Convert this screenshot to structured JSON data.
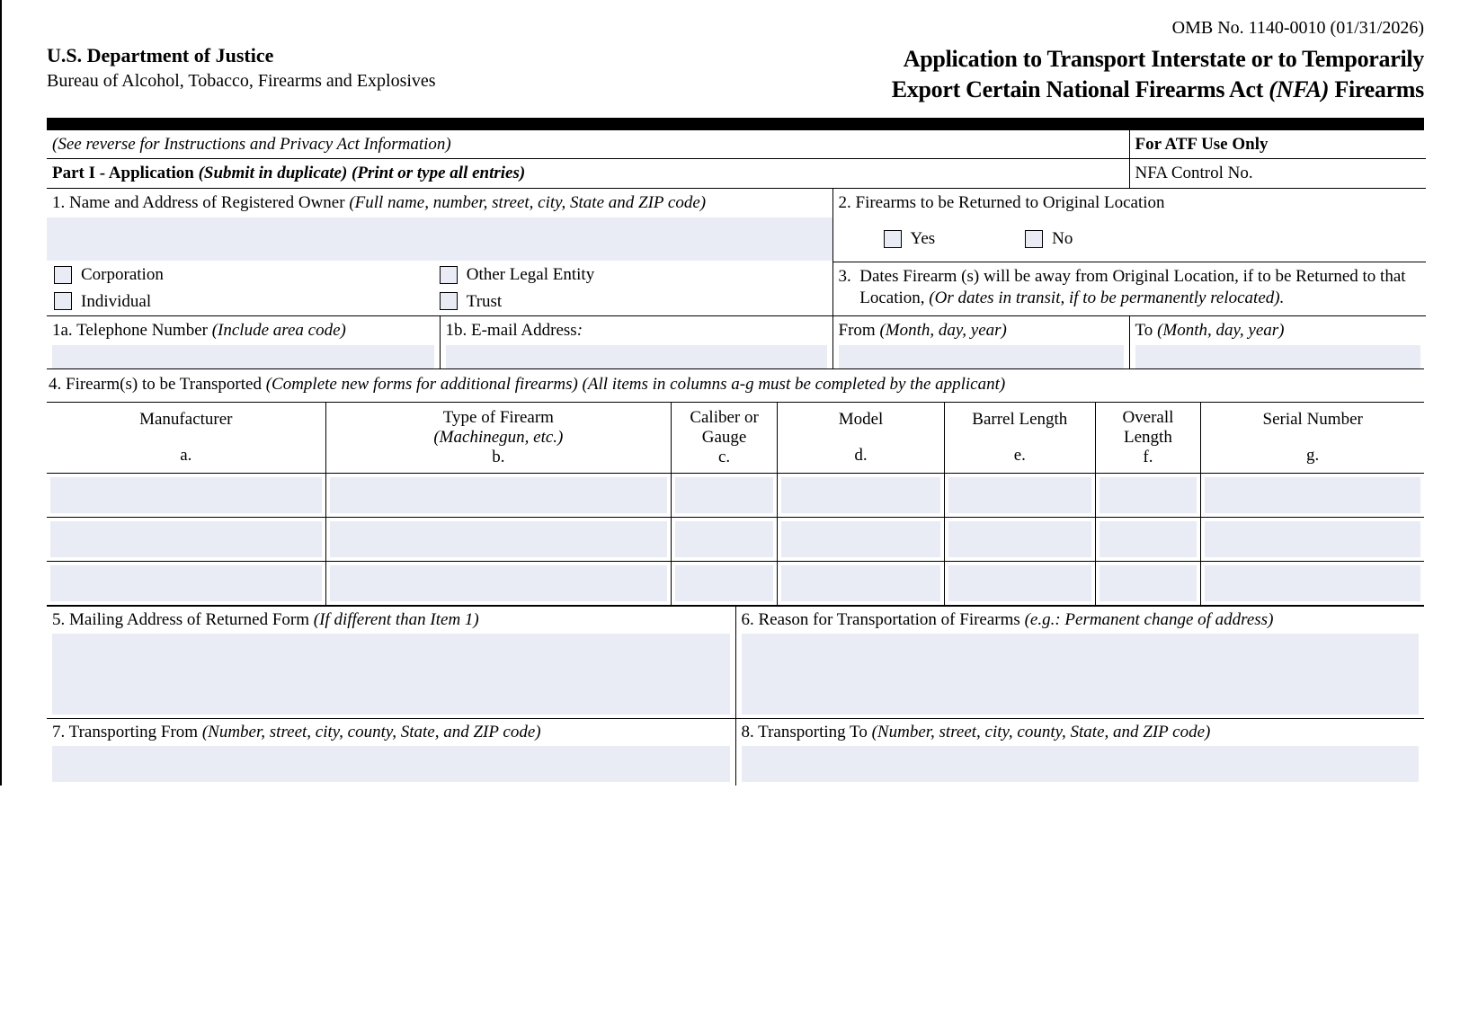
{
  "omb": "OMB No. 1140-0010 (01/31/2026)",
  "header": {
    "dept": "U.S. Department of Justice",
    "bureau": "Bureau of Alcohol, Tobacco, Firearms and Explosives",
    "title_line1": "Application to Transport Interstate or to Temporarily",
    "title_line2_a": "Export Certain National Firearms Act ",
    "title_line2_b": "(NFA)",
    "title_line2_c": " Firearms"
  },
  "instr_note": "(See reverse for Instructions and Privacy Act Information)",
  "atf_use": "For  ATF Use Only",
  "nfa_control": "NFA Control No.",
  "part1_a": "Part I - Application ",
  "part1_b": "(Submit in duplicate) (Print or type all entries)",
  "field1": {
    "num": "1.  ",
    "label": "Name and Address of Registered Owner ",
    "hint": "(Full name, number, street, city, State and ZIP code)"
  },
  "entity": {
    "corp": "Corporation",
    "other": "Other Legal Entity",
    "indiv": "Individual",
    "trust": "Trust"
  },
  "field1a_num": "1a.  ",
  "field1a_label": "Telephone Number  ",
  "field1a_hint": "(Include area code)",
  "field1b_num": "1b.  ",
  "field1b_label": "E-mail Address",
  "field1b_colon": ":",
  "field2": {
    "num": "2.  ",
    "label": "Firearms to be Returned to Original Location",
    "yes": "Yes",
    "no": "No"
  },
  "field3": {
    "num": "3.  ",
    "label_a": "Dates Firearm (s) will be away from Original Location, if to be Returned to that Location, ",
    "label_b": "(Or dates in transit, if to be permanently relocated).",
    "from_a": "From ",
    "from_b": "(Month, day, year)",
    "to_a": "To  ",
    "to_b": "(Month, day, year)"
  },
  "field4": {
    "num": "4.  ",
    "label": "Firearm(s) to be Transported ",
    "hint": "(Complete new forms for additional firearms) (All items in columns a-g must be completed by the applicant)"
  },
  "cols": {
    "a1": "Manufacturer",
    "a2": "a.",
    "b1": "Type of Firearm",
    "b1i": "(Machinegun, etc.)",
    "b2": "b.",
    "c1": "Caliber or Gauge",
    "c2": "c.",
    "d1": "Model",
    "d2": "d.",
    "e1": "Barrel Length",
    "e2": "e.",
    "f1": "Overall Length",
    "f2": "f.",
    "g1": "Serial Number",
    "g2": "g."
  },
  "field5": {
    "num": "5.  ",
    "label": "Mailing Address of Returned Form ",
    "hint": "(If different than Item 1)"
  },
  "field6": {
    "num": "6.  ",
    "label": "Reason for Transportation of Firearms ",
    "hint": "(e.g.: Permanent change of address)"
  },
  "field7": {
    "num": "7.  ",
    "label": "Transporting From ",
    "hint": "(Number, street, city, county, State, and ZIP code)"
  },
  "field8": {
    "num": "8.  ",
    "label": "Transporting To ",
    "hint": "(Number, street, city, county, State, and ZIP code)"
  }
}
